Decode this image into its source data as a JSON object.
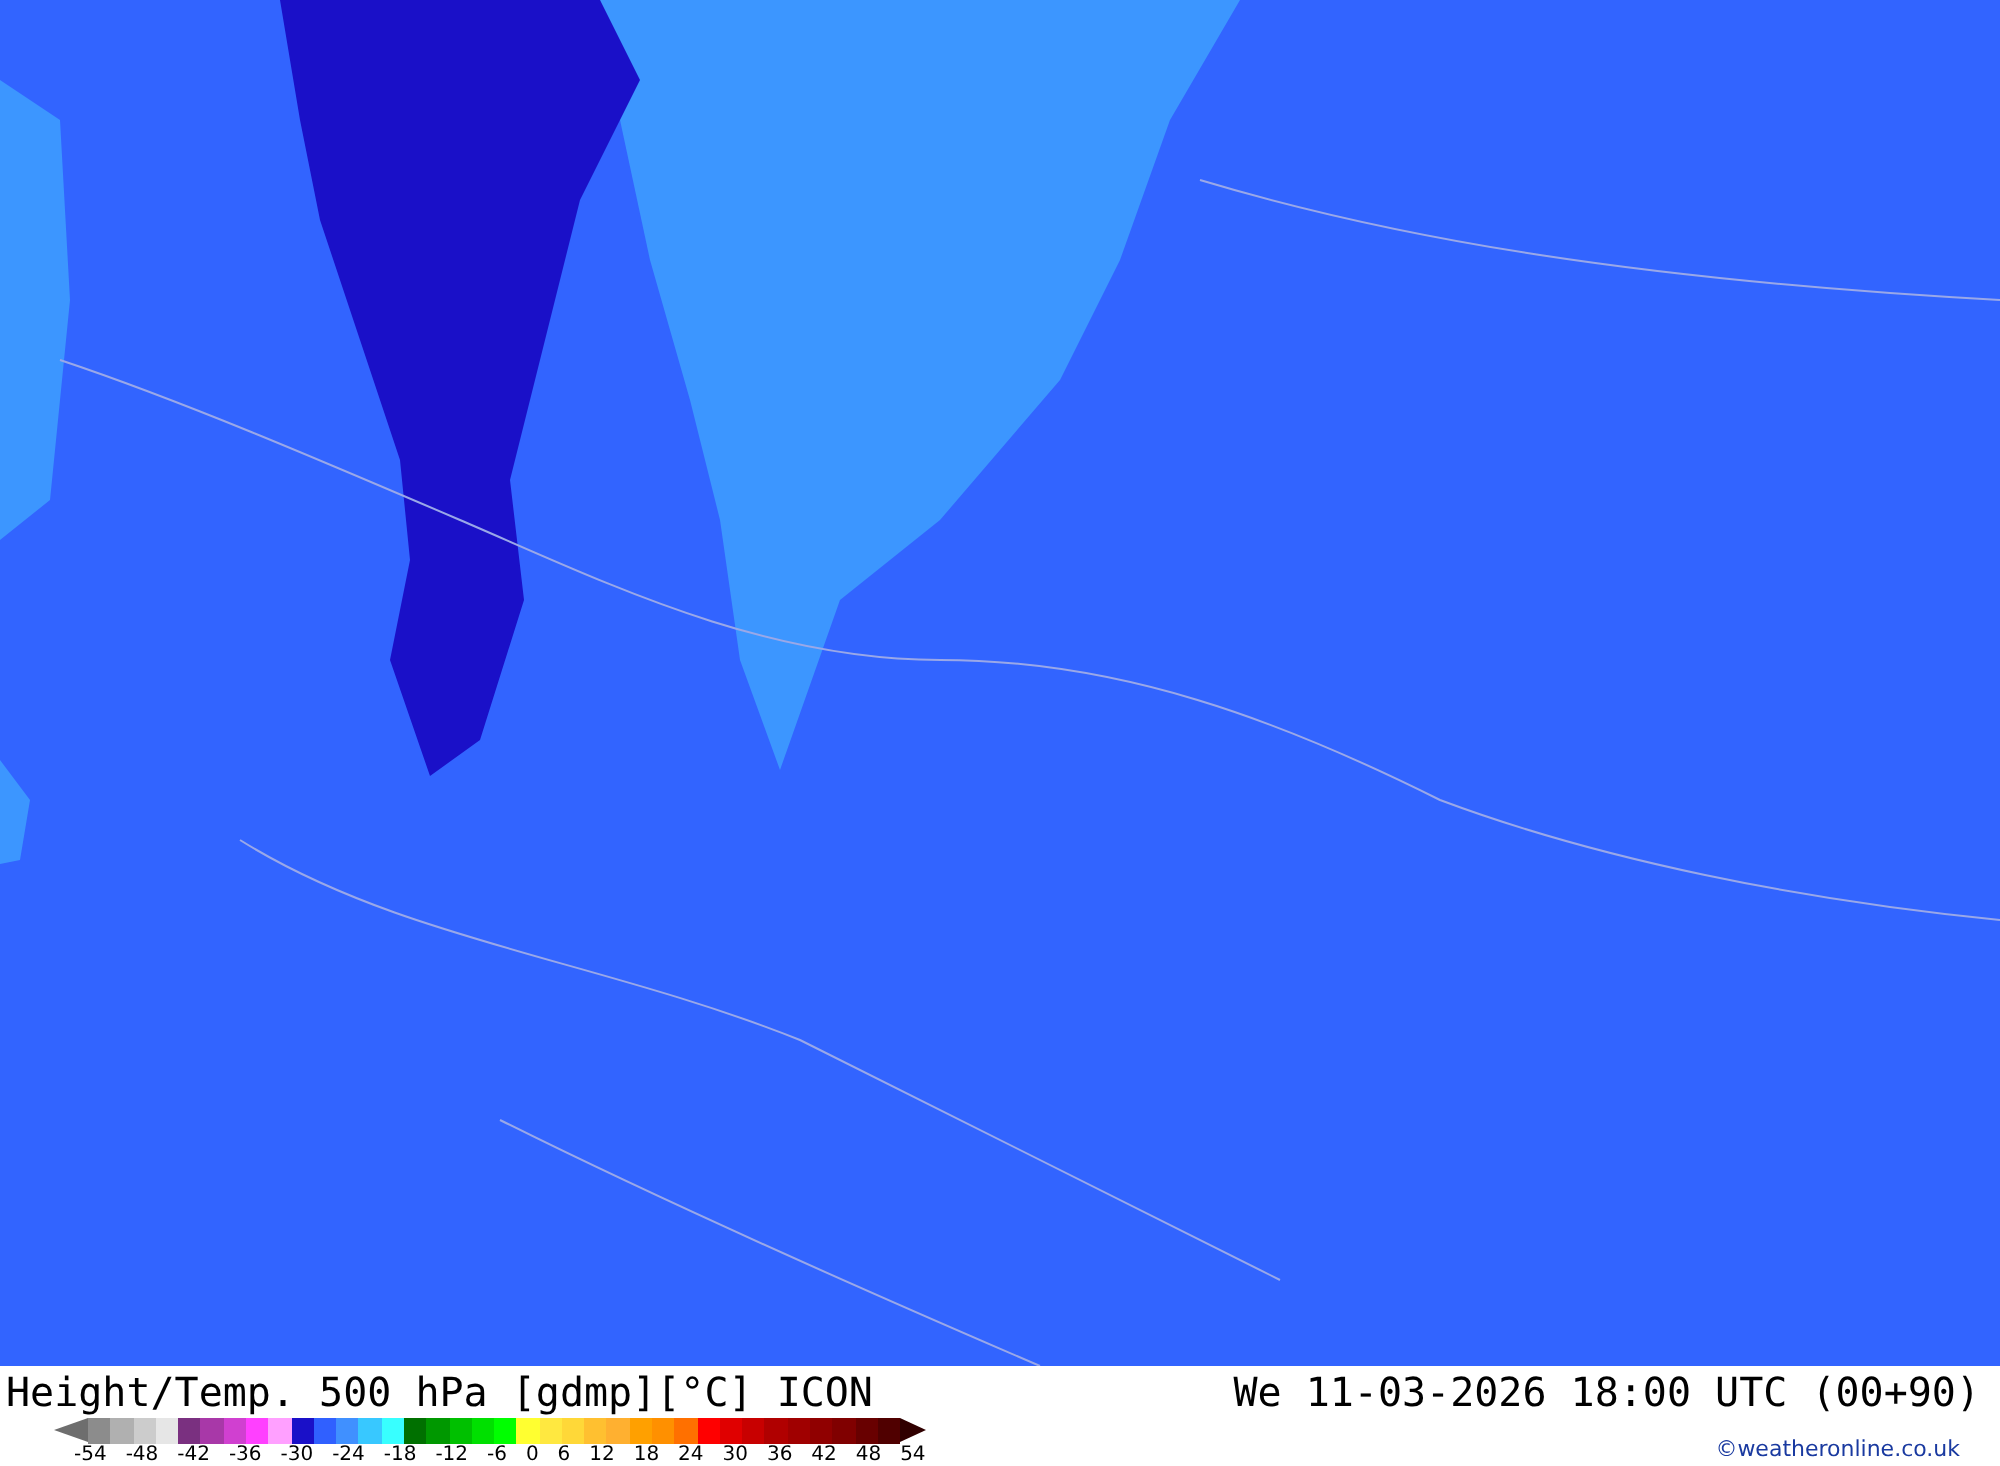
{
  "title": "Height/Temp. 500 hPa [gdmp][°C] ICON",
  "valid_time": "We 11-03-2026 18:00 UTC (00+90)",
  "legend": {
    "swatches": [
      {
        "kind": "arrow-left",
        "color": "#6e6e6e"
      },
      {
        "kind": "box",
        "color": "#8c8c8c"
      },
      {
        "kind": "box",
        "color": "#b0b0b0"
      },
      {
        "kind": "box",
        "color": "#cccccc"
      },
      {
        "kind": "box",
        "color": "#e6e6e6"
      },
      {
        "kind": "box",
        "color": "#7a3080"
      },
      {
        "kind": "box",
        "color": "#a838a8"
      },
      {
        "kind": "box",
        "color": "#d040d0"
      },
      {
        "kind": "box",
        "color": "#ff40ff"
      },
      {
        "kind": "box",
        "color": "#ffa0ff"
      },
      {
        "kind": "box",
        "color": "#1a10c8"
      },
      {
        "kind": "box",
        "color": "#3060ff"
      },
      {
        "kind": "box",
        "color": "#4090ff"
      },
      {
        "kind": "box",
        "color": "#38c8ff"
      },
      {
        "kind": "box",
        "color": "#38ffff"
      },
      {
        "kind": "box",
        "color": "#007000"
      },
      {
        "kind": "box",
        "color": "#009800"
      },
      {
        "kind": "box",
        "color": "#00c000"
      },
      {
        "kind": "box",
        "color": "#00e000"
      },
      {
        "kind": "box",
        "color": "#00ff00"
      },
      {
        "kind": "box",
        "color": "#ffff30"
      },
      {
        "kind": "box",
        "color": "#ffe840"
      },
      {
        "kind": "box",
        "color": "#ffd838"
      },
      {
        "kind": "box",
        "color": "#ffc030"
      },
      {
        "kind": "box",
        "color": "#ffb030"
      },
      {
        "kind": "box",
        "color": "#ffa000"
      },
      {
        "kind": "box",
        "color": "#ff9000"
      },
      {
        "kind": "box",
        "color": "#ff7000"
      },
      {
        "kind": "box",
        "color": "#ff0000"
      },
      {
        "kind": "box",
        "color": "#e00000"
      },
      {
        "kind": "box",
        "color": "#c80000"
      },
      {
        "kind": "box",
        "color": "#b00000"
      },
      {
        "kind": "box",
        "color": "#a00000"
      },
      {
        "kind": "box",
        "color": "#900000"
      },
      {
        "kind": "box",
        "color": "#800000"
      },
      {
        "kind": "box",
        "color": "#680000"
      },
      {
        "kind": "box",
        "color": "#500000"
      },
      {
        "kind": "arrow-right",
        "color": "#300000"
      }
    ],
    "labels": [
      "-54",
      "-48",
      "-42",
      "-36",
      "-30",
      "-24",
      "-18",
      "-12",
      "-6",
      "0",
      "6",
      "12",
      "18",
      "24",
      "30",
      "36",
      "42",
      "48",
      "54"
    ]
  },
  "credit": "©weatheronline.co.uk"
}
